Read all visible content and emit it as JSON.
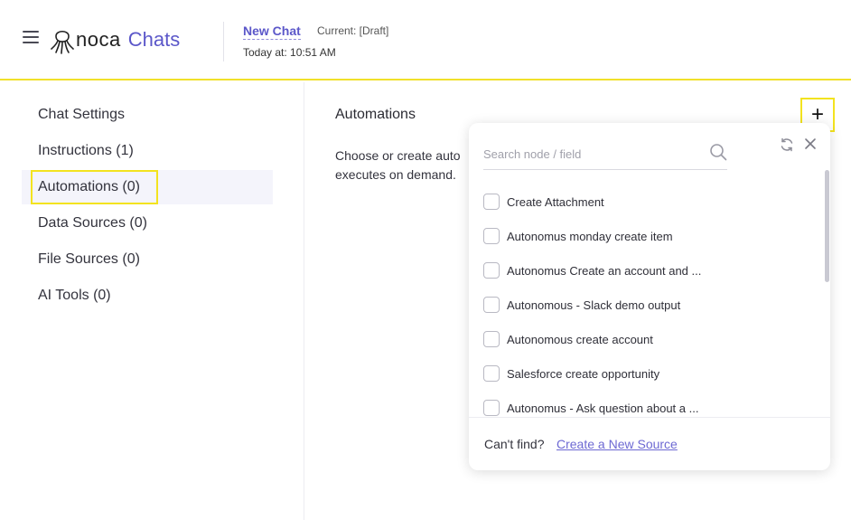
{
  "header": {
    "menu_icon": "hamburger-menu-icon",
    "logo_icon": "octopus-logo-icon",
    "logo_text": "noca",
    "app_name": "Chats",
    "chat_name": "New Chat",
    "chat_status": "Current: [Draft]",
    "chat_time": "Today at: 10:51 AM"
  },
  "sidebar": {
    "items": [
      {
        "label": "Chat Settings"
      },
      {
        "label": "Instructions (1)"
      },
      {
        "label": "Automations (0)"
      },
      {
        "label": "Data Sources (0)"
      },
      {
        "label": "File Sources (0)"
      },
      {
        "label": "AI Tools (0)"
      }
    ],
    "active_index": 2
  },
  "main": {
    "title": "Automations",
    "description_line1": "Choose or create auto",
    "description_line2": "executes on demand.",
    "add_icon": "plus-icon"
  },
  "popover": {
    "search_placeholder": "Search node / field",
    "search_value": "",
    "items": [
      {
        "label": "Create Attachment"
      },
      {
        "label": "Autonomus monday create item"
      },
      {
        "label": "Autonomus Create an account and ..."
      },
      {
        "label": "Autonomous - Slack demo output"
      },
      {
        "label": "Autonomous create account"
      },
      {
        "label": "Salesforce create opportunity"
      },
      {
        "label": "Autonomus - Ask question about a ..."
      }
    ],
    "footer_text": "Can't find?",
    "footer_link": "Create a New Source"
  },
  "colors": {
    "accent": "#5b57c9",
    "link": "#6d69d3",
    "highlight": "#f3e31f",
    "header_border": "#f1e12a"
  }
}
